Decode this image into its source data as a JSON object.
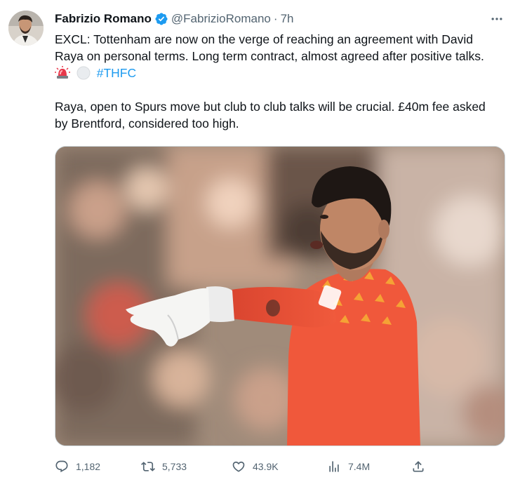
{
  "author": {
    "name": "Fabrizio Romano",
    "handle": "@FabrizioRomano",
    "separator": "·",
    "time": "7h"
  },
  "tweet": {
    "paragraph1": "EXCL: Tottenham are now on the verge of reaching an agreement with David Raya on personal terms. Long term contract, almost agreed after positive talks.",
    "hashtag": "#THFC",
    "paragraph2": "Raya, open to Spurs move but club to club talks will be crucial. £40m fee asked by Brentford, considered too high."
  },
  "actions": {
    "replies": "1,182",
    "retweets": "5,733",
    "likes": "43.9K",
    "views": "7.4M"
  },
  "icons": [
    "verified-badge-icon",
    "more-icon",
    "siren-emoji",
    "white-circle-emoji",
    "reply-icon",
    "retweet-icon",
    "like-icon",
    "views-icon",
    "share-icon"
  ],
  "colors": {
    "link": "#1d9bf0",
    "verified": "#1d9bf0",
    "secondary_text": "#536471",
    "jersey": "#f0573a"
  }
}
